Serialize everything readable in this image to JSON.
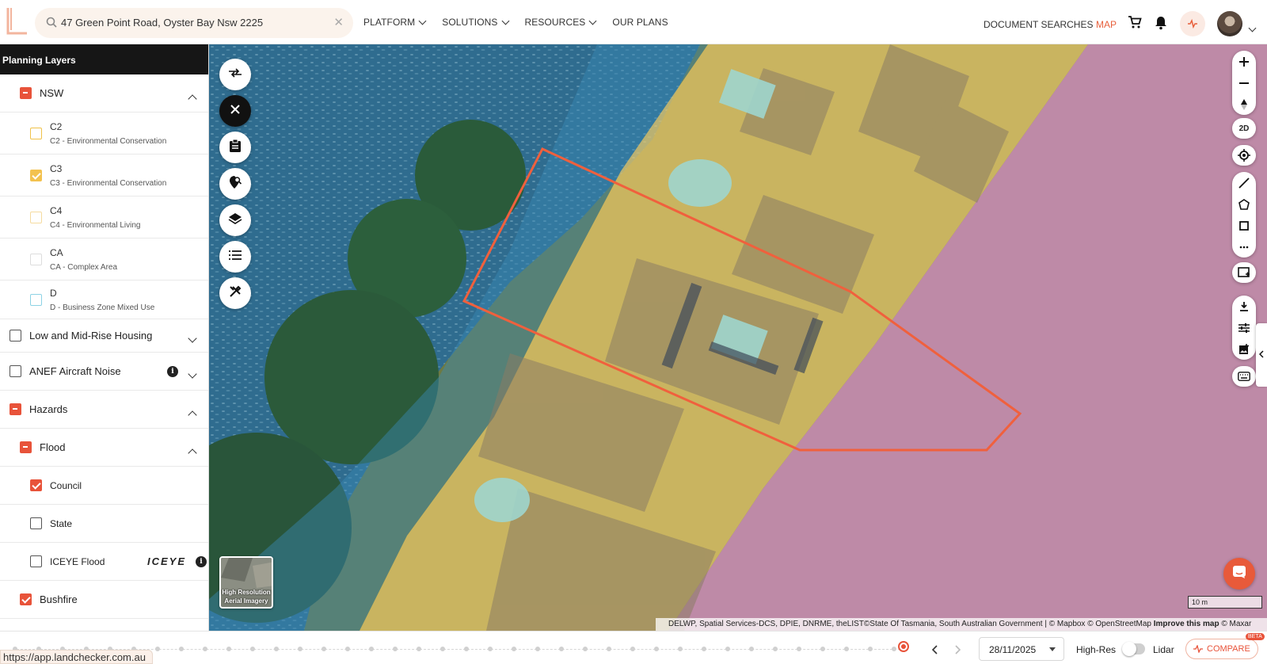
{
  "header": {
    "search": {
      "value": "47 Green Point Road, Oyster Bay Nsw 2225"
    },
    "nav": [
      {
        "label": "PLATFORM",
        "dropdown": true
      },
      {
        "label": "SOLUTIONS",
        "dropdown": true
      },
      {
        "label": "RESOURCES",
        "dropdown": true
      },
      {
        "label": "OUR PLANS",
        "dropdown": false
      }
    ],
    "document_searches": "DOCUMENT SEARCHES",
    "map_link": "MAP",
    "accent_color": "#e8603c"
  },
  "sidebar": {
    "title": "Planning Layers",
    "nsw": {
      "label": "NSW",
      "state": "partial",
      "expanded": true
    },
    "zones": [
      {
        "code": "C2",
        "name": "C2 - Environmental Conservation",
        "checked": false,
        "color": "#f0c24a"
      },
      {
        "code": "C3",
        "name": "C3 - Environmental Conservation",
        "checked": true,
        "color": "#f3c24f"
      },
      {
        "code": "C4",
        "name": "C4 - Environmental Living",
        "checked": false,
        "color": "#f5dba0"
      },
      {
        "code": "CA",
        "name": "CA - Complex Area",
        "checked": false,
        "color": "#dddddd"
      },
      {
        "code": "D",
        "name": "D - Business Zone Mixed Use",
        "checked": false,
        "color": "#8dd3e5"
      }
    ],
    "low_mid_rise": {
      "label": "Low and Mid-Rise Housing",
      "checked": false
    },
    "anef": {
      "label": "ANEF Aircraft Noise",
      "checked": false,
      "info_icon": "i"
    },
    "hazards": {
      "label": "Hazards",
      "state": "partial"
    },
    "flood": {
      "label": "Flood",
      "state": "partial"
    },
    "flood_items": [
      {
        "label": "Council",
        "checked": true
      },
      {
        "label": "State",
        "checked": false
      },
      {
        "label": "ICEYE Flood",
        "checked": false,
        "brand": "ICEYE",
        "info_icon": "i"
      }
    ],
    "bushfire": {
      "label": "Bushfire",
      "checked": true
    }
  },
  "map": {
    "left_tools": [
      "swap-icon",
      "close-icon",
      "clipboard-icon",
      "location-search-icon",
      "layers-icon",
      "list-icon",
      "tools-icon"
    ],
    "right_tools": {
      "view_mode": "2D",
      "icons": [
        "zoom-in-icon",
        "zoom-out-icon",
        "compass-icon",
        "locate-icon",
        "measure-line-icon",
        "polygon-icon",
        "square-icon",
        "more-icon",
        "screenshot-icon",
        "download-icon",
        "sliders-icon",
        "image-icon",
        "keyboard-icon"
      ]
    },
    "basemap_thumb": "High Resolution Aerial Imagery",
    "scale": "10 m",
    "attribution": "DELWP, Spatial Services-DCS, DPIE, DNRME, theLIST©State Of Tasmania, South Australian Government | © Mapbox © OpenStreetMap",
    "attribution_improve": "Improve this map",
    "attribution_maxar": "© Maxar"
  },
  "timeline": {
    "date": "28/11/2025",
    "high_res": "High-Res",
    "lidar": "Lidar",
    "compare": "COMPARE",
    "beta": "BETA"
  },
  "status_url": "https://app.landchecker.com.au"
}
